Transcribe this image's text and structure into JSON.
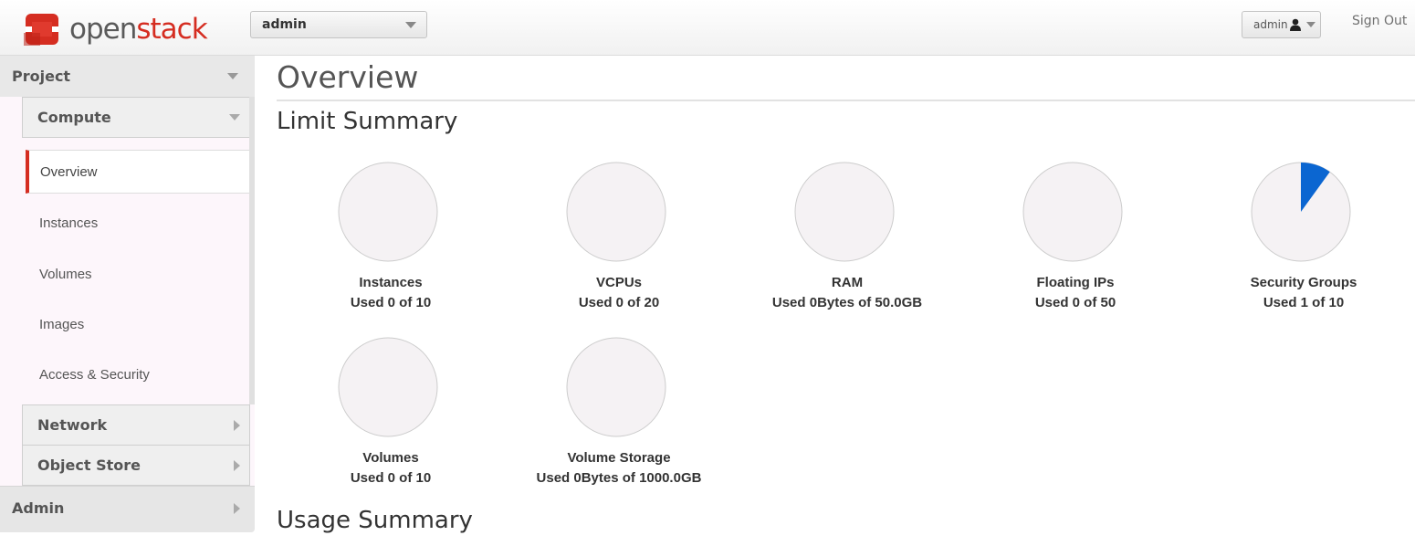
{
  "brand": {
    "logo_prefix": "open",
    "logo_suffix": "stack",
    "logo_icon": "openstack-logo-icon",
    "accent_color": "#d52d21"
  },
  "header": {
    "project_selector": "admin",
    "user_menu": "admin",
    "user_icon": "user-icon",
    "sign_out": "Sign Out"
  },
  "sidebar": {
    "project_label": "Project",
    "compute_label": "Compute",
    "compute_items": [
      {
        "label": "Overview",
        "active": true
      },
      {
        "label": "Instances",
        "active": false
      },
      {
        "label": "Volumes",
        "active": false
      },
      {
        "label": "Images",
        "active": false
      },
      {
        "label": "Access & Security",
        "active": false
      }
    ],
    "network_label": "Network",
    "object_store_label": "Object Store",
    "admin_label": "Admin"
  },
  "main": {
    "page_title": "Overview",
    "limit_summary_heading": "Limit Summary",
    "usage_summary_heading": "Usage Summary"
  },
  "limits": [
    {
      "name": "Instances",
      "used_text": "Used 0 of 10",
      "used": 0,
      "total": 10
    },
    {
      "name": "VCPUs",
      "used_text": "Used 0 of 20",
      "used": 0,
      "total": 20
    },
    {
      "name": "RAM",
      "used_text": "Used 0Bytes of 50.0GB",
      "used": 0,
      "total": 50.0
    },
    {
      "name": "Floating IPs",
      "used_text": "Used 0 of 50",
      "used": 0,
      "total": 50
    },
    {
      "name": "Security Groups",
      "used_text": "Used 1 of 10",
      "used": 1,
      "total": 10
    },
    {
      "name": "Volumes",
      "used_text": "Used 0 of 10",
      "used": 0,
      "total": 10
    },
    {
      "name": "Volume Storage",
      "used_text": "Used 0Bytes of 1000.0GB",
      "used": 0,
      "total": 1000.0
    }
  ],
  "colors": {
    "pie_fill": "#f5f2f4",
    "pie_stroke": "#cccccc",
    "pie_used": "#0b66d1"
  }
}
